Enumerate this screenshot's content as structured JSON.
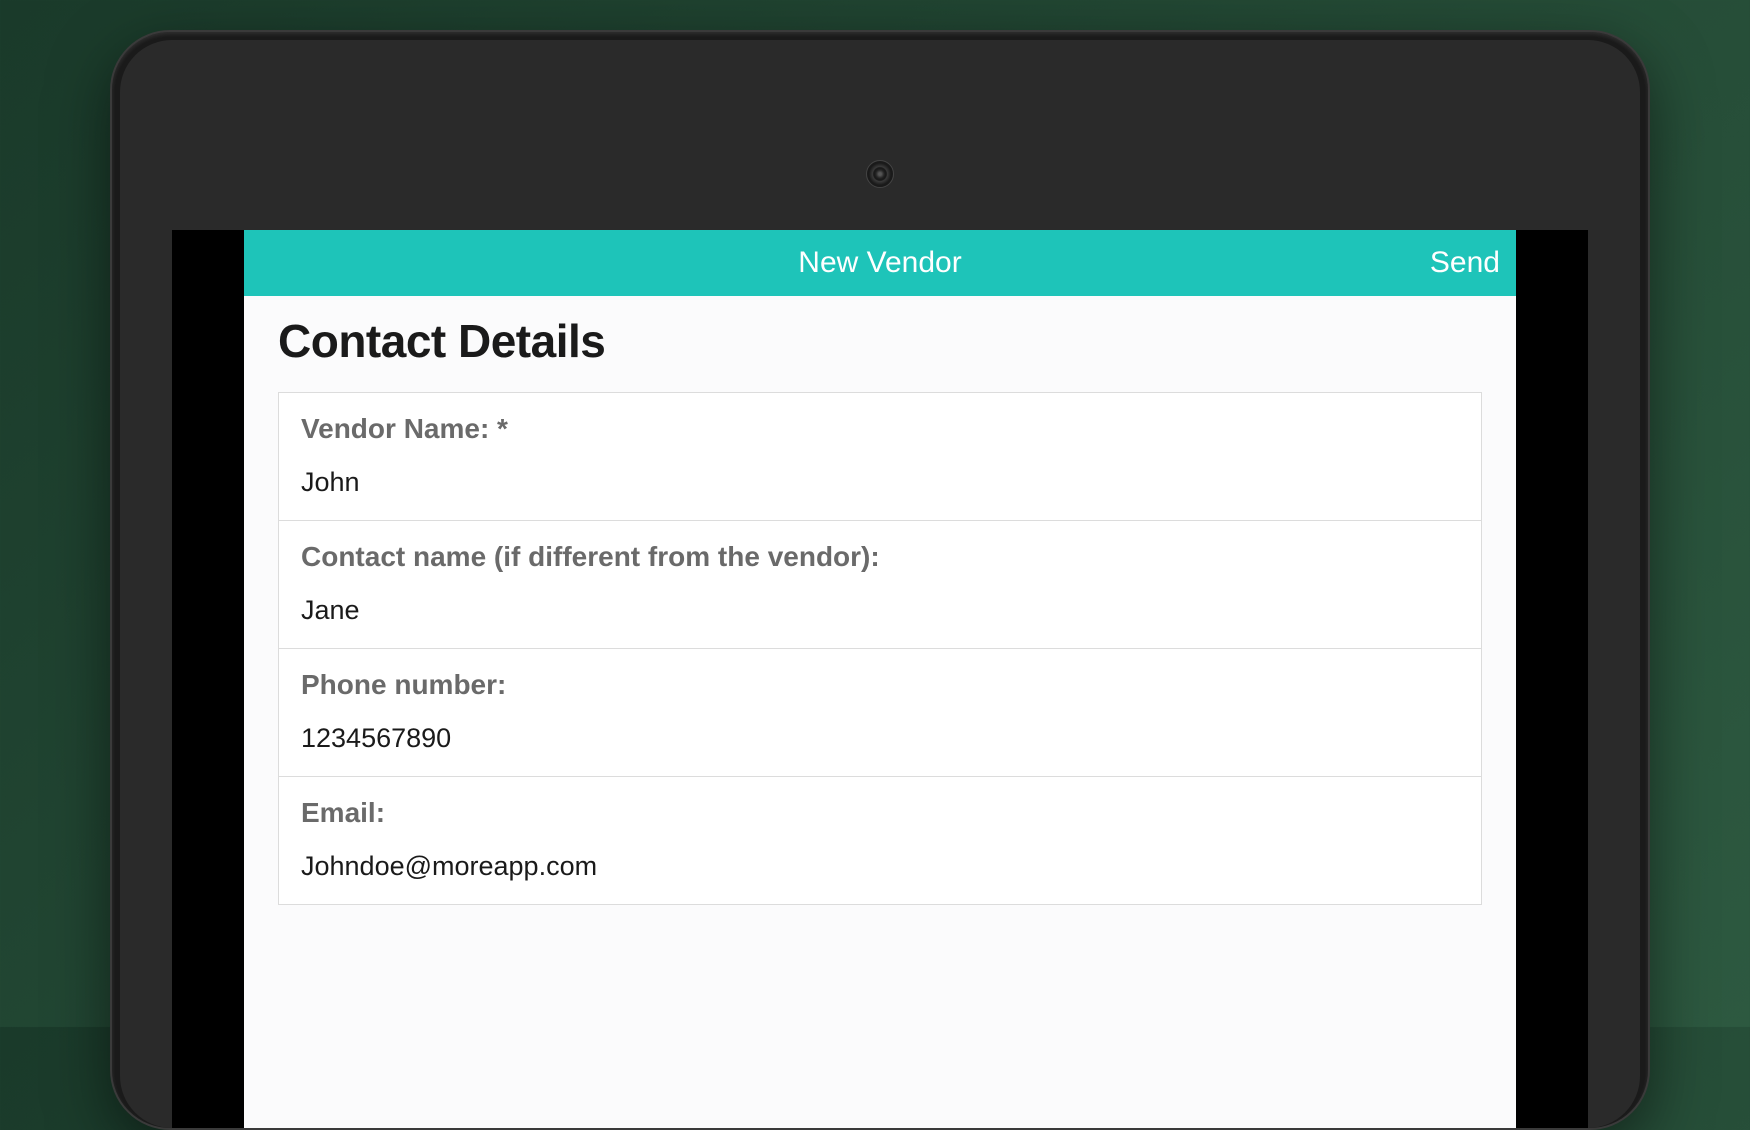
{
  "header": {
    "title": "New Vendor",
    "send_label": "Send"
  },
  "section": {
    "title": "Contact Details"
  },
  "fields": [
    {
      "label": "Vendor Name: *",
      "value": "John"
    },
    {
      "label": "Contact name (if different from the vendor):",
      "value": "Jane"
    },
    {
      "label": "Phone number:",
      "value": "1234567890"
    },
    {
      "label": "Email:",
      "value": "Johndoe@moreapp.com"
    }
  ]
}
